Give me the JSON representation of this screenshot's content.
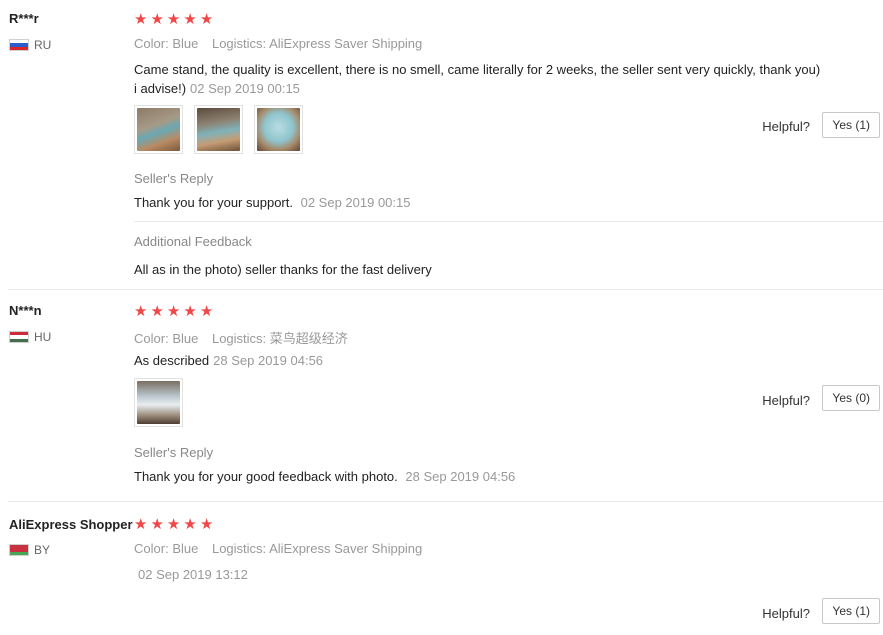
{
  "reviews": [
    {
      "user": "R***r",
      "country": "RU",
      "rating": 5,
      "color_label": "Color:",
      "color_value": "Blue",
      "logistics_label": "Logistics:",
      "logistics_value": "AliExpress Saver Shipping",
      "text_line1": "Came stand, the quality is excellent, there is no smell, came literally for 2 weeks, the seller sent very quickly, thank you)",
      "text_line2": "i advise!)",
      "date": "02 Sep 2019 00:15",
      "photos": 3,
      "seller_reply_title": "Seller's Reply",
      "seller_reply_text": "Thank you for your support.",
      "seller_reply_date": "02 Sep 2019 00:15",
      "additional_title": "Additional Feedback",
      "additional_text": "All as in the photo) seller thanks for the fast delivery",
      "helpful_label": "Helpful?",
      "yes_label": "Yes (1)"
    },
    {
      "user": "N***n",
      "country": "HU",
      "rating": 5,
      "color_label": "Color:",
      "color_value": "Blue",
      "logistics_label": "Logistics:",
      "logistics_value": "菜鸟超级经济",
      "text_line1": "As described",
      "date": "28 Sep 2019 04:56",
      "photos": 1,
      "seller_reply_title": "Seller's Reply",
      "seller_reply_text": "Thank you for your good feedback with photo.",
      "seller_reply_date": "28 Sep 2019 04:56",
      "helpful_label": "Helpful?",
      "yes_label": "Yes (0)"
    },
    {
      "user": "AliExpress Shopper",
      "country": "BY",
      "rating": 5,
      "color_label": "Color:",
      "color_value": "Blue",
      "logistics_label": "Logistics:",
      "logistics_value": "AliExpress Saver Shipping",
      "date": "02 Sep 2019 13:12",
      "helpful_label": "Helpful?",
      "yes_label": "Yes (1)"
    }
  ],
  "colors": {
    "star": "#f04848",
    "muted": "#999999",
    "text": "#222222",
    "separator": "#e8e8e8"
  },
  "icons": {
    "star": "star-icon",
    "flag_ru": "flag-ru-icon",
    "flag_hu": "flag-hu-icon",
    "flag_by": "flag-by-icon"
  }
}
